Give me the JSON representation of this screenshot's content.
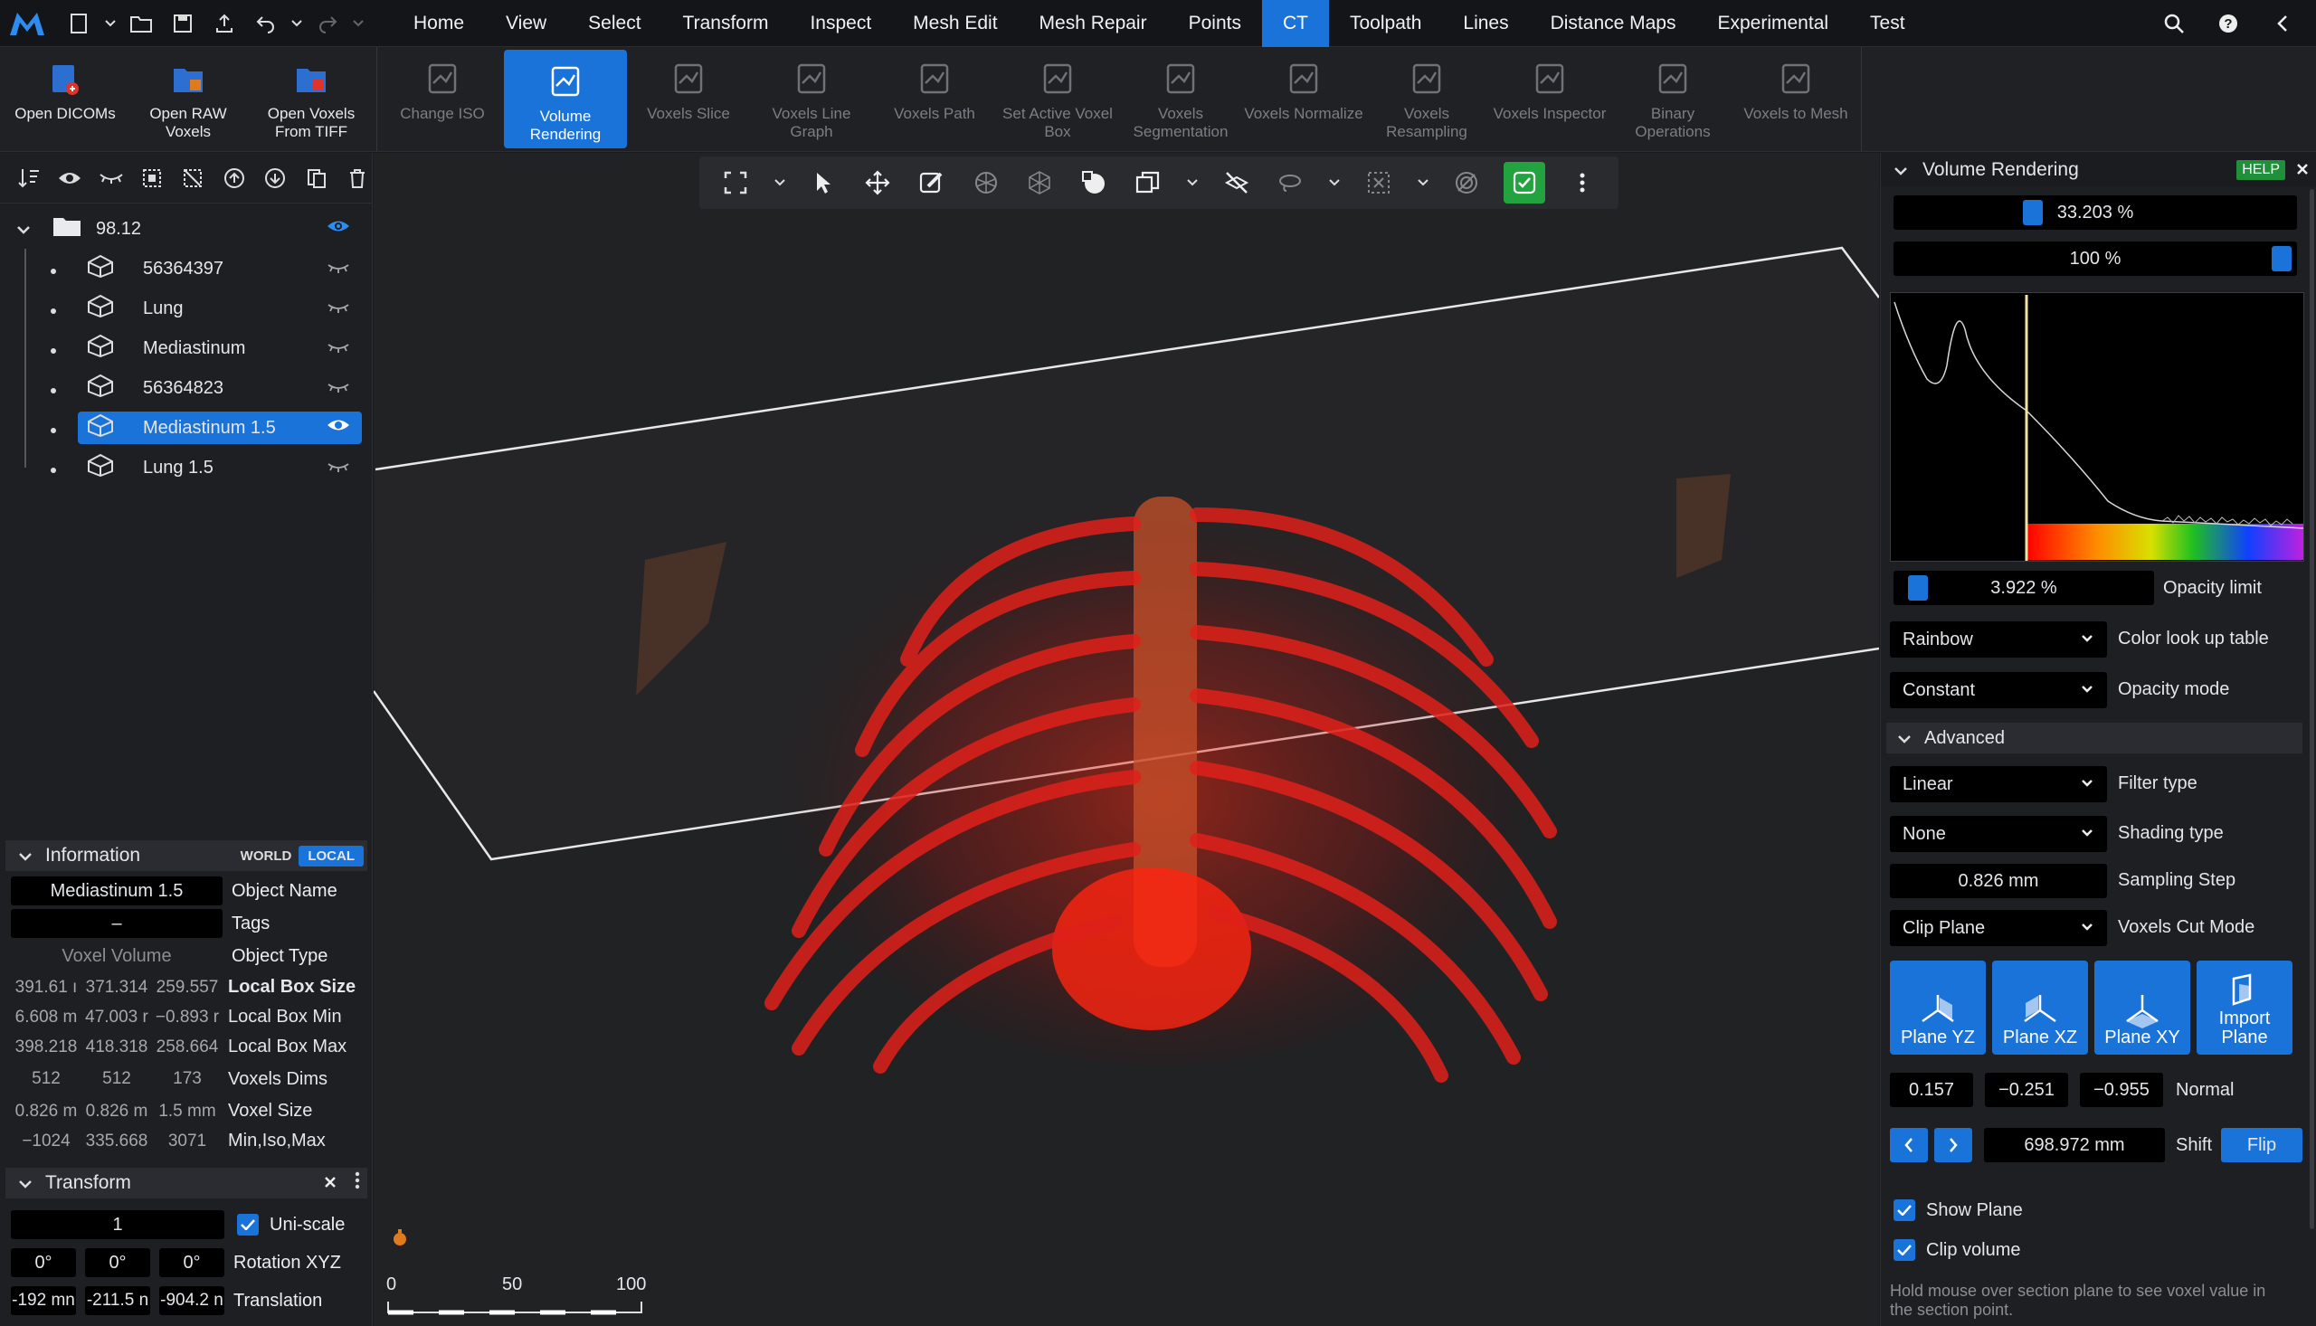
{
  "menubar": {
    "items": [
      "Home",
      "View",
      "Select",
      "Transform",
      "Inspect",
      "Mesh Edit",
      "Mesh Repair",
      "Points",
      "CT",
      "Toolpath",
      "Lines",
      "Distance Maps",
      "Experimental",
      "Test"
    ],
    "active": "CT"
  },
  "ribbon": {
    "buttons": [
      {
        "label": "Open DICOMs",
        "icon": "open-dicoms-icon",
        "enabled": true
      },
      {
        "label": "Open RAW Voxels",
        "icon": "open-raw-voxels-icon",
        "enabled": true
      },
      {
        "label": "Open Voxels From TIFF",
        "icon": "open-tiff-icon",
        "enabled": true
      },
      {
        "label": "Change ISO",
        "icon": "change-iso-icon",
        "enabled": false
      },
      {
        "label": "Volume Rendering",
        "icon": "volume-rendering-icon",
        "enabled": true,
        "selected": true
      },
      {
        "label": "Voxels Slice",
        "icon": "voxels-slice-icon",
        "enabled": false
      },
      {
        "label": "Voxels Line Graph",
        "icon": "line-graph-icon",
        "enabled": false
      },
      {
        "label": "Voxels Path",
        "icon": "voxels-path-icon",
        "enabled": false
      },
      {
        "label": "Set Active Voxel Box",
        "icon": "voxel-box-icon",
        "enabled": false
      },
      {
        "label": "Voxels Segmentation",
        "icon": "segmentation-icon",
        "enabled": false
      },
      {
        "label": "Voxels Normalize",
        "icon": "normalize-icon",
        "enabled": false
      },
      {
        "label": "Voxels Resampling",
        "icon": "resampling-icon",
        "enabled": false
      },
      {
        "label": "Voxels Inspector",
        "icon": "inspector-icon",
        "enabled": false
      },
      {
        "label": "Binary Operations",
        "icon": "binary-ops-icon",
        "enabled": false
      },
      {
        "label": "Voxels to Mesh",
        "icon": "voxels-to-mesh-icon",
        "enabled": false
      }
    ]
  },
  "tree": {
    "root": "98.12",
    "children": [
      {
        "name": "56364397",
        "visible": false
      },
      {
        "name": "Lung",
        "visible": false
      },
      {
        "name": "Mediastinum",
        "visible": false
      },
      {
        "name": "56364823",
        "visible": false
      },
      {
        "name": "Mediastinum 1.5",
        "visible": true,
        "selected": true
      },
      {
        "name": "Lung 1.5",
        "visible": false
      }
    ]
  },
  "info": {
    "title": "Information",
    "world": "WORLD",
    "local": "LOCAL",
    "object_name": "Mediastinum 1.5",
    "object_name_label": "Object Name",
    "tags": "–",
    "tags_label": "Tags",
    "object_type": "Voxel Volume",
    "object_type_label": "Object Type",
    "rows": [
      {
        "label": "Local Box Size",
        "v": [
          "391.61 ı",
          "371.314",
          "259.557"
        ]
      },
      {
        "label": "Local Box Min",
        "v": [
          "6.608 m",
          "47.003 r",
          "−0.893 r"
        ]
      },
      {
        "label": "Local Box Max",
        "v": [
          "398.218",
          "418.318",
          "258.664"
        ]
      },
      {
        "label": "Voxels Dims",
        "v": [
          "512",
          "512",
          "173"
        ]
      },
      {
        "label": "Voxel Size",
        "v": [
          "0.826 m",
          "0.826 m",
          "1.5 mm"
        ]
      },
      {
        "label": "Min,Iso,Max",
        "v": [
          "−1024",
          "335.668",
          "3071"
        ]
      }
    ]
  },
  "transform": {
    "title": "Transform",
    "scale": "1",
    "uniscale_label": "Uni-scale",
    "rotation": [
      "0°",
      "0°",
      "0°"
    ],
    "rotation_label": "Rotation XYZ",
    "translation": [
      "-192 mn",
      "-211.5 n",
      "-904.2 n"
    ],
    "translation_label": "Translation"
  },
  "scalebar": {
    "ticks": [
      "0",
      "50",
      "100"
    ]
  },
  "volume_panel": {
    "title": "Volume Rendering",
    "help": "HELP",
    "min_pct": "33.203 %",
    "min_value": 0.33203,
    "max_pct": "100 %",
    "max_value": 1.0,
    "opacity_pct": "3.922 %",
    "opacity_value": 0.03922,
    "opacity_label": "Opacity limit",
    "color_lut": "Rainbow",
    "color_lut_label": "Color look up table",
    "opacity_mode": "Constant",
    "opacity_mode_label": "Opacity mode",
    "advanced": "Advanced",
    "filter": "Linear",
    "filter_label": "Filter type",
    "shading": "None",
    "shading_label": "Shading type",
    "sampling": "0.826 mm",
    "sampling_label": "Sampling Step",
    "cutmode": "Clip Plane",
    "cutmode_label": "Voxels Cut Mode",
    "planes": [
      "Plane YZ",
      "Plane XZ",
      "Plane XY",
      "Import Plane"
    ],
    "normal": [
      "0.157",
      "−0.251",
      "−0.955"
    ],
    "normal_label": "Normal",
    "shift": "698.972 mm",
    "shift_label": "Shift",
    "flip": "Flip",
    "show_plane": "Show Plane",
    "clip_volume": "Clip volume",
    "hint": "Hold mouse over section plane to see voxel value in the section point."
  },
  "colors": {
    "accent": "#1a73d9",
    "help": "#1f8f3a",
    "render": "#d81a14"
  }
}
